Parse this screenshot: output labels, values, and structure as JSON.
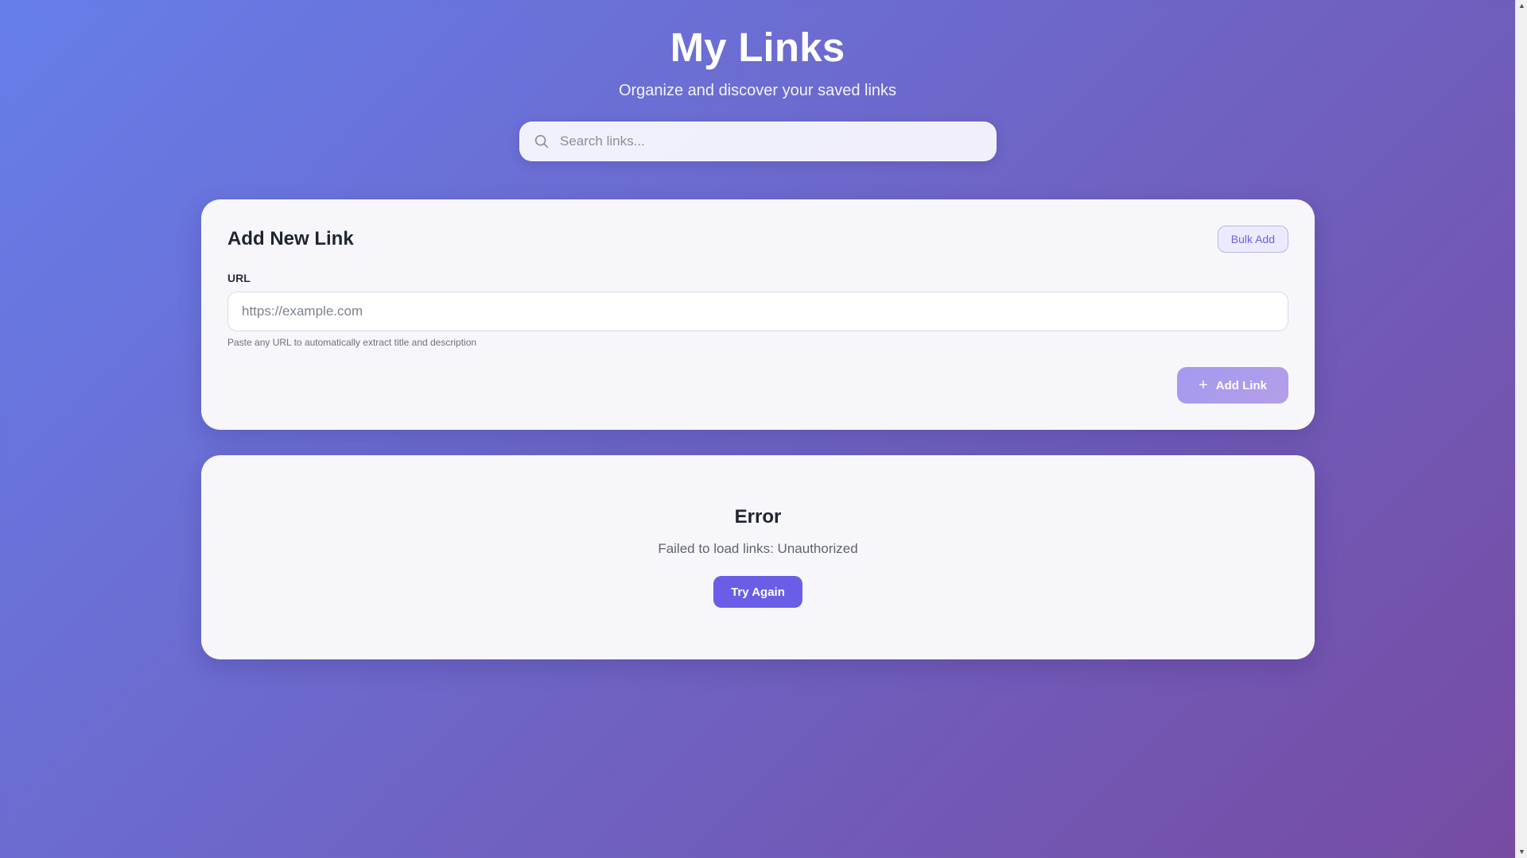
{
  "header": {
    "title": "My Links",
    "subtitle": "Organize and discover your saved links"
  },
  "search": {
    "icon": "search-icon",
    "placeholder": "Search links...",
    "value": ""
  },
  "add_link_card": {
    "title": "Add New Link",
    "bulk_add_label": "Bulk Add",
    "url_label": "URL",
    "url_placeholder": "https://example.com",
    "url_value": "",
    "hint": "Paste any URL to automatically extract title and description",
    "add_button_icon": "plus-icon",
    "add_button_label": "Add Link"
  },
  "error_card": {
    "title": "Error",
    "message": "Failed to load links: Unauthorized",
    "retry_label": "Try Again"
  },
  "colors": {
    "background_start": "#667eea",
    "background_end": "#764ba2",
    "accent": "#6a5de6",
    "card_background": "#f7f7fb"
  }
}
